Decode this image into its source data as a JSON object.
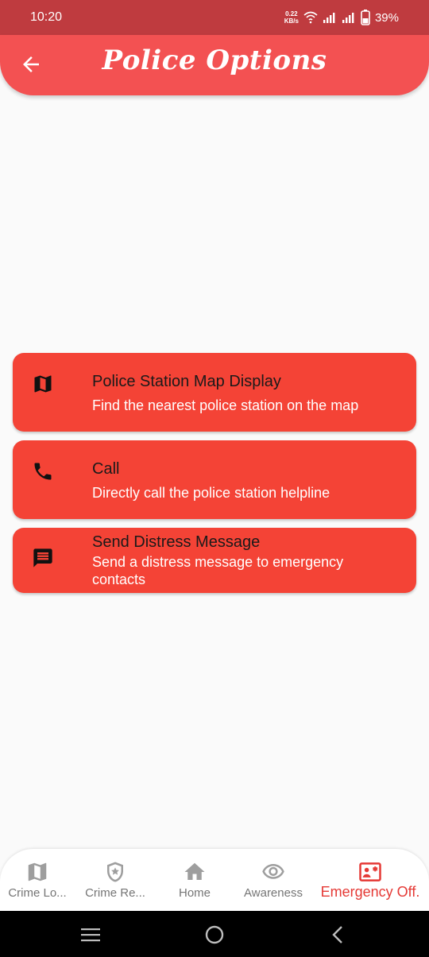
{
  "status_bar": {
    "time": "10:20",
    "net_speed_value": "0.22",
    "net_speed_unit": "KB/s",
    "battery": "39%"
  },
  "app_bar": {
    "title": "Police Options"
  },
  "options": [
    {
      "icon": "map-icon",
      "title": "Police Station Map Display",
      "subtitle": "Find the nearest police station on the map"
    },
    {
      "icon": "phone-icon",
      "title": "Call",
      "subtitle": "Directly call the police station helpline"
    },
    {
      "icon": "message-icon",
      "title": "Send Distress Message",
      "subtitle": "Send a distress message to emergency contacts"
    }
  ],
  "bottom_nav": {
    "items": [
      {
        "icon": "map-icon",
        "label": "Crime Lo..."
      },
      {
        "icon": "shield-star-icon",
        "label": "Crime Re..."
      },
      {
        "icon": "home-icon",
        "label": "Home"
      },
      {
        "icon": "eye-icon",
        "label": "Awareness"
      },
      {
        "icon": "contact-emergency-icon",
        "label": "Emergency Off.",
        "active": true
      }
    ]
  },
  "colors": {
    "status_bar": "#bf3b3f",
    "app_bar": "#f35152",
    "card": "#f44336",
    "active_nav": "#e53935",
    "inactive_nav": "#757575"
  }
}
